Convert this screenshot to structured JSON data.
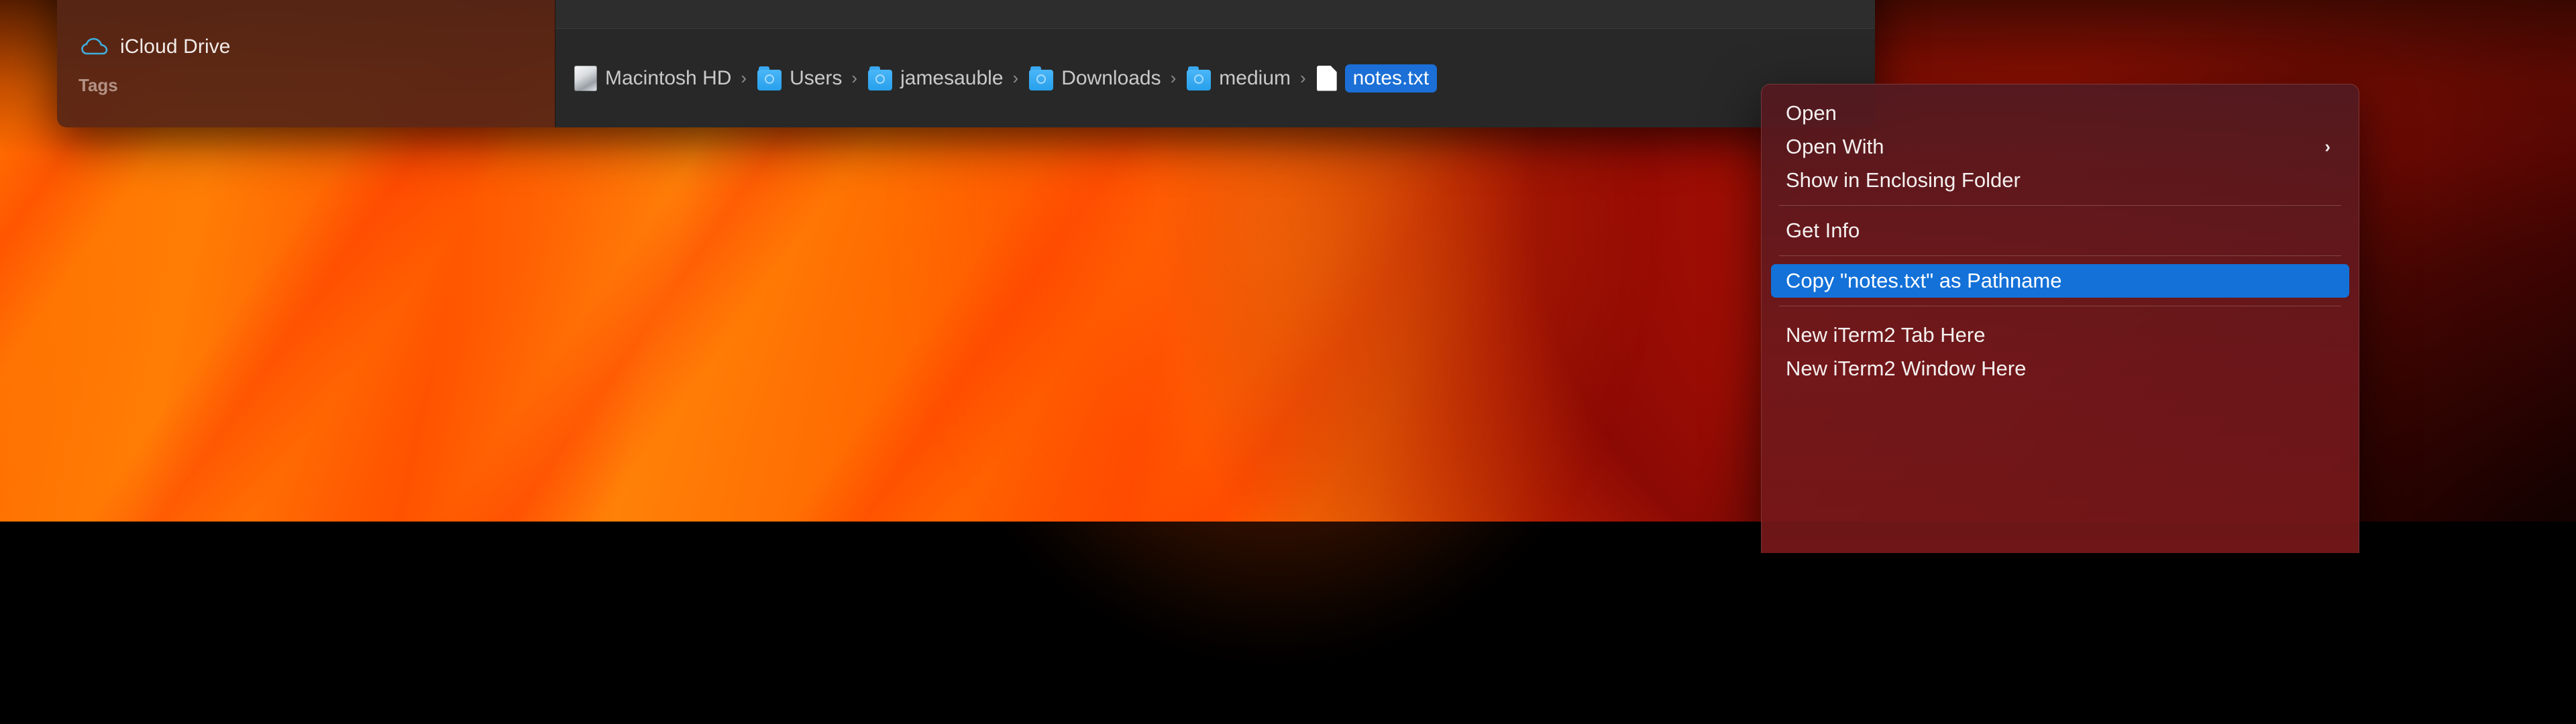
{
  "desktop": {
    "wallpaper_name": "ventura-orange-red-swirl",
    "accent_orange": "#ff6a00",
    "accent_red": "#c31405"
  },
  "finder": {
    "sidebar": {
      "items": [
        {
          "label": "iCloud Drive",
          "icon": "icloud-drive-icon"
        }
      ],
      "section_header": "Tags"
    },
    "pathbar": {
      "crumbs": [
        {
          "label": "Macintosh HD",
          "icon": "hard-drive-icon",
          "selected": false
        },
        {
          "label": "Users",
          "icon": "folder-icon",
          "selected": false
        },
        {
          "label": "jamesauble",
          "icon": "folder-icon",
          "selected": false
        },
        {
          "label": "Downloads",
          "icon": "folder-icon",
          "selected": false
        },
        {
          "label": "medium",
          "icon": "folder-icon",
          "selected": false
        },
        {
          "label": "notes.txt",
          "icon": "document-icon",
          "selected": true
        }
      ],
      "separator_glyph": "›"
    }
  },
  "context_menu": {
    "highlight_color": "#1371d8",
    "submenu_glyph": "›",
    "items": [
      {
        "label": "Open",
        "type": "item",
        "submenu": false,
        "highlighted": false
      },
      {
        "label": "Open With",
        "type": "item",
        "submenu": true,
        "highlighted": false
      },
      {
        "label": "Show in Enclosing Folder",
        "type": "item",
        "submenu": false,
        "highlighted": false
      },
      {
        "label": "",
        "type": "separator",
        "submenu": false,
        "highlighted": false
      },
      {
        "label": "Get Info",
        "type": "item",
        "submenu": false,
        "highlighted": false
      },
      {
        "label": "",
        "type": "separator",
        "submenu": false,
        "highlighted": false
      },
      {
        "label": "Copy \"notes.txt\" as Pathname",
        "type": "item",
        "submenu": false,
        "highlighted": true
      },
      {
        "label": "",
        "type": "separator",
        "submenu": false,
        "highlighted": false
      },
      {
        "label": "New iTerm2 Tab Here",
        "type": "item",
        "submenu": false,
        "highlighted": false
      },
      {
        "label": "New iTerm2 Window Here",
        "type": "item",
        "submenu": false,
        "highlighted": false
      }
    ]
  }
}
